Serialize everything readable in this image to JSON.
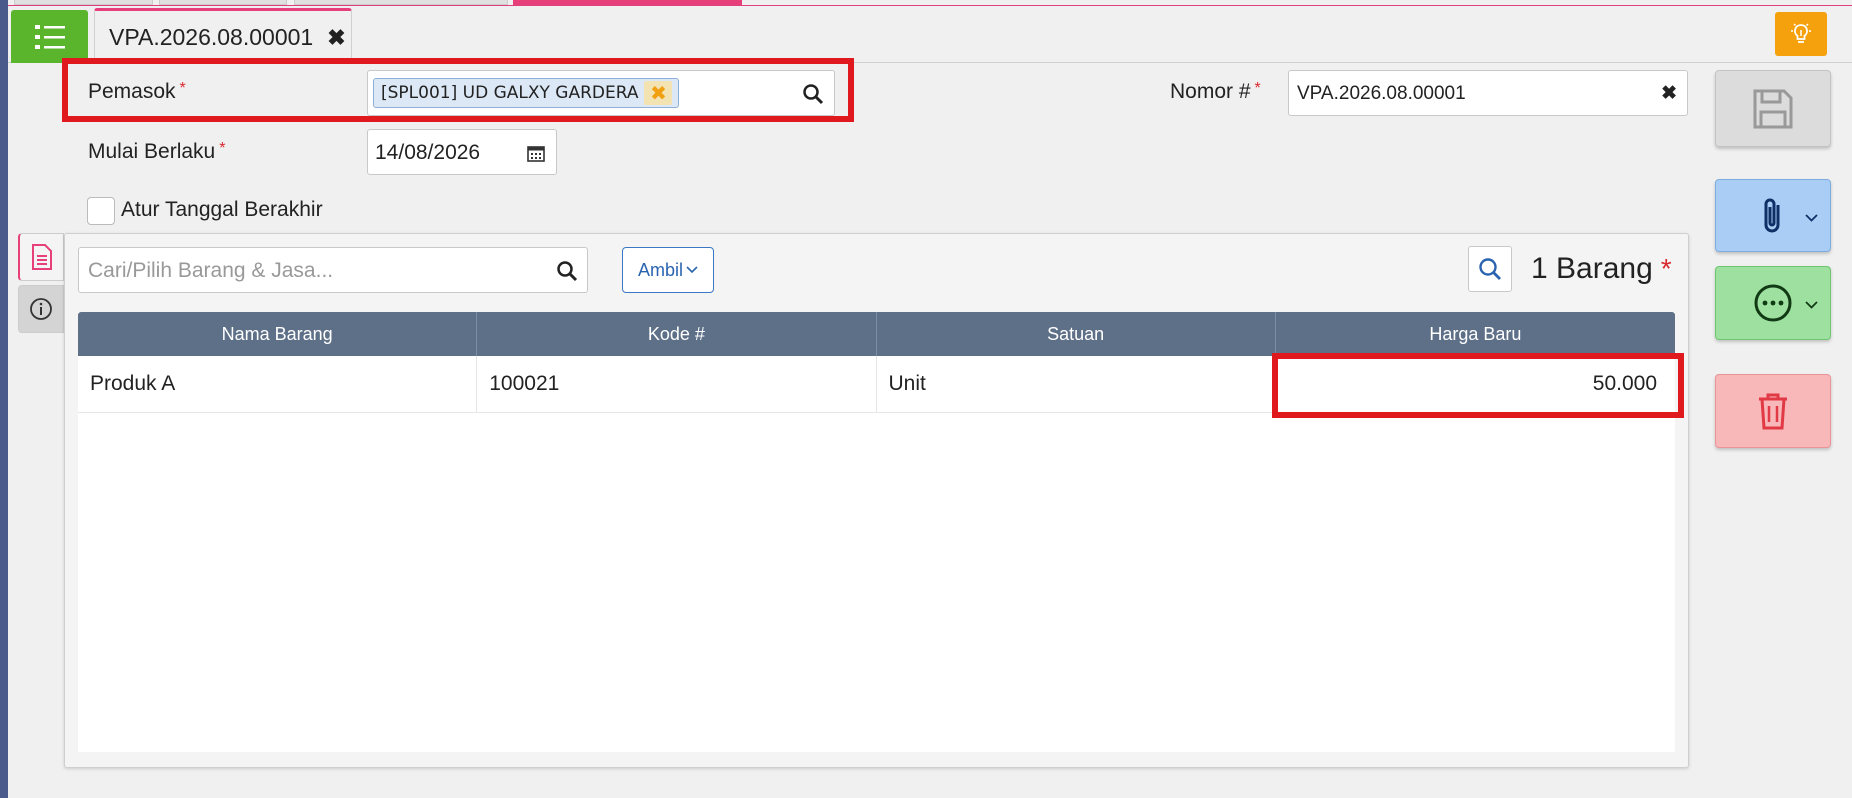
{
  "window": {
    "tab_title": "VPA.2026.08.00001"
  },
  "form": {
    "supplier_label": "Pemasok",
    "supplier_required": "*",
    "supplier_chip": "[SPL001] UD GALXY GARDERA",
    "number_label": "Nomor #",
    "number_required": "*",
    "number_value": "VPA.2026.08.00001",
    "effective_label": "Mulai Berlaku",
    "effective_required": "*",
    "effective_value": "14/08/2026",
    "end_date_label": "Atur Tanggal Berakhir"
  },
  "items": {
    "search_placeholder": "Cari/Pilih Barang & Jasa...",
    "ambil_label": "Ambil",
    "count_label": "1 Barang",
    "count_required": "*",
    "columns": [
      "Nama Barang",
      "Kode #",
      "Satuan",
      "Harga Baru"
    ],
    "rows": [
      {
        "name": "Produk A",
        "code": "100021",
        "unit": "Unit",
        "price": "50.000"
      }
    ]
  },
  "icons": {
    "menu": "list-icon",
    "close_tab": "close-icon",
    "hint": "lightbulb-icon",
    "save": "save-icon",
    "attach": "paperclip-icon",
    "more": "more-options-icon",
    "delete": "trash-icon",
    "calendar": "calendar-icon",
    "search": "search-icon",
    "details_tab": "document-icon",
    "info_tab": "info-icon"
  },
  "colors": {
    "menu_green": "#5ab52c",
    "tab_accent": "#e63f7a",
    "hint_orange": "#f5a10d",
    "table_header": "#5d7088",
    "attach_blue": "#a9cdf5",
    "more_green": "#9ee0a0",
    "delete_red": "#f8b7b9",
    "highlight_red": "#e0191e"
  }
}
